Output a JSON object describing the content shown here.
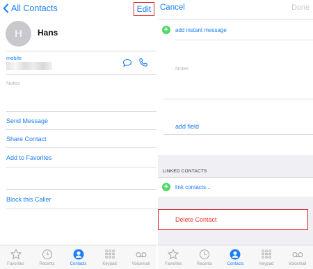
{
  "left": {
    "back_label": "All Contacts",
    "edit_label": "Edit",
    "avatar_initial": "H",
    "name": "Hans",
    "mobile_label": "mobile",
    "notes_placeholder": "Notes",
    "actions": [
      "Send Message",
      "Share Contact",
      "Add to Favorites"
    ],
    "block_label": "Block this Caller"
  },
  "right": {
    "cancel_label": "Cancel",
    "done_label": "Done",
    "add_instant_message": "add instant message",
    "notes_placeholder": "Notes",
    "add_field": "add field",
    "linked_header": "LINKED CONTACTS",
    "link_contacts": "link contacts...",
    "delete_label": "Delete Contact"
  },
  "tabs": [
    {
      "label": "Favorites",
      "icon": "star-icon",
      "active": false
    },
    {
      "label": "Recents",
      "icon": "clock-icon",
      "active": false
    },
    {
      "label": "Contacts",
      "icon": "person-icon",
      "active": true
    },
    {
      "label": "Keypad",
      "icon": "keypad-icon",
      "active": false
    },
    {
      "label": "Voicemail",
      "icon": "voicemail-icon",
      "active": false
    }
  ],
  "colors": {
    "accent": "#1a7ef5",
    "delete": "#e7342f",
    "highlight": "#d8262b",
    "add": "#4cd964"
  }
}
